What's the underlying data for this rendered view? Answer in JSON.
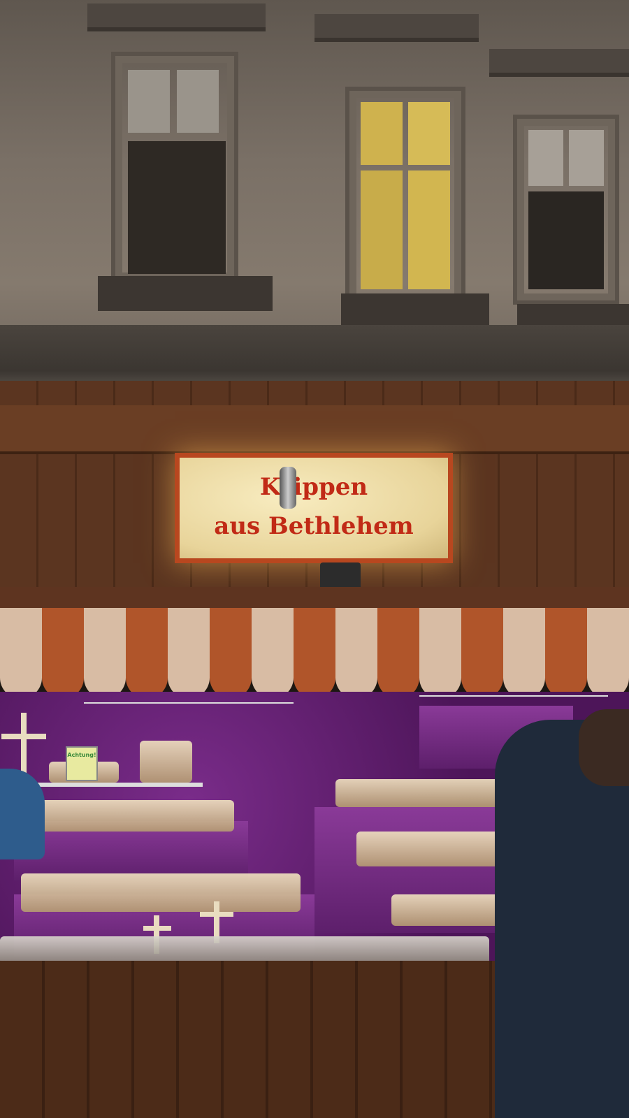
{
  "sign": {
    "line1": "Krippen",
    "line2": "aus Bethlehem"
  },
  "notice": {
    "label": "Achtung!"
  },
  "colors": {
    "sign_text": "#c12a16",
    "sign_border": "#b8471f",
    "velvet": "#5a1a68",
    "awning_a": "#b85a2a",
    "awning_b": "#e8d2b8"
  }
}
